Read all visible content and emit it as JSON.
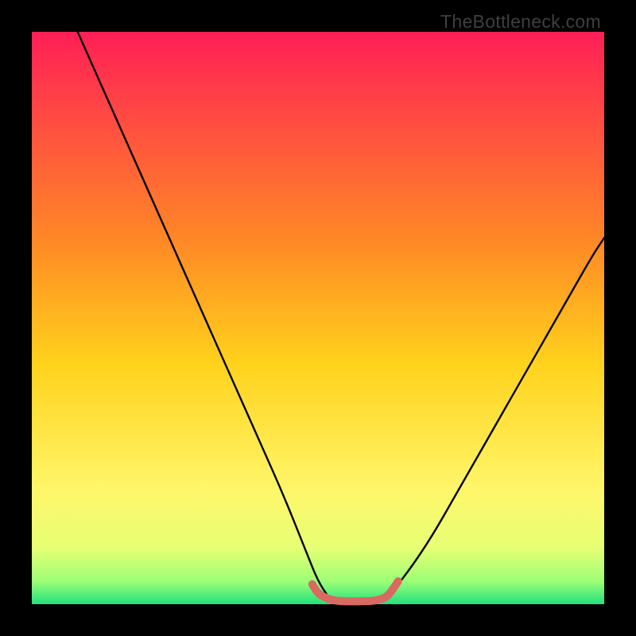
{
  "watermark": "TheBottleneck.com",
  "colors": {
    "top": "#ff1f56",
    "mid_upper": "#ff8a25",
    "mid": "#ffd21c",
    "mid_lower": "#fff66a",
    "lower": "#e8ff74",
    "near_bottom": "#9dff76",
    "bottom": "#22e07e",
    "curve": "#000000",
    "accent": "#d86a62",
    "frame": "#000000"
  },
  "chart_data": {
    "type": "line",
    "title": "",
    "xlabel": "",
    "ylabel": "",
    "xlim": [
      0,
      100
    ],
    "ylim": [
      0,
      100
    ],
    "grid": false,
    "legend": false,
    "series": [
      {
        "name": "left-branch",
        "x": [
          8,
          12,
          16,
          20,
          24,
          28,
          32,
          36,
          40,
          44,
          48,
          50,
          52
        ],
        "y": [
          100,
          91,
          82,
          73,
          64,
          55,
          46,
          37,
          28,
          19,
          9,
          4,
          1
        ]
      },
      {
        "name": "right-branch",
        "x": [
          62,
          66,
          70,
          74,
          78,
          82,
          86,
          90,
          94,
          98,
          100
        ],
        "y": [
          1,
          6,
          12,
          19,
          26,
          33,
          40,
          47,
          54,
          61,
          64
        ]
      },
      {
        "name": "valley-floor",
        "x": [
          49,
          50,
          52,
          54,
          56,
          58,
          60,
          62,
          63,
          64
        ],
        "y": [
          3.5,
          1.8,
          0.8,
          0.5,
          0.5,
          0.5,
          0.6,
          1.2,
          2.5,
          4
        ]
      }
    ],
    "gradient_stops": [
      {
        "pct": 0,
        "key": "top"
      },
      {
        "pct": 37,
        "key": "mid_upper"
      },
      {
        "pct": 58,
        "key": "mid"
      },
      {
        "pct": 80,
        "key": "mid_lower"
      },
      {
        "pct": 90,
        "key": "lower"
      },
      {
        "pct": 96,
        "key": "near_bottom"
      },
      {
        "pct": 100,
        "key": "bottom"
      }
    ]
  }
}
